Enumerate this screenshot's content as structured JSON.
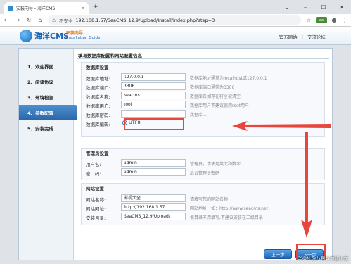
{
  "browser": {
    "tab_title": "安装向导 - 海洋CMS",
    "not_secure": "不安全",
    "url": "192.168.1.57/SeaCMS_12.9/Upload/Install/index.php?step=3",
    "ext_badge": "aa"
  },
  "header": {
    "logo_text": "海洋CMS",
    "guide_cn": "安装向导",
    "guide_en": "Installation Guide",
    "link_official": "官方网站",
    "link_separator": "|",
    "link_forum": "交流论坛"
  },
  "sidebar": {
    "items": [
      {
        "label": "1、欢迎界面"
      },
      {
        "label": "2、阅读协议"
      },
      {
        "label": "3、环境检测"
      },
      {
        "label": "4、参数配置"
      },
      {
        "label": "5、安装完成"
      }
    ]
  },
  "content": {
    "title": "填写数据库配置和网站配置信息",
    "db": {
      "heading": "数据库设置",
      "host": {
        "label": "数据库地址:",
        "value": "127.0.0.1",
        "hint": "数据库地址通常为localhost或127.0.0.1"
      },
      "port": {
        "label": "数据库端口:",
        "value": "3306",
        "hint": "数据库端口通常为3306"
      },
      "name": {
        "label": "数据库名称:",
        "value": "seacms",
        "hint": "数据库名如存在将全被清空"
      },
      "user": {
        "label": "数据库用户:",
        "value": "root",
        "hint": "数据库用户不建议使用root用户"
      },
      "password": {
        "label": "数据库密码:",
        "value": "",
        "hint": "数据库..."
      },
      "charset": {
        "label": "数据库编码:",
        "value": "UTF8"
      }
    },
    "admin": {
      "heading": "管理员设置",
      "username": {
        "label": "用户名:",
        "value": "admin",
        "hint": "管理员，请使用英文和数字"
      },
      "password": {
        "label": "密　码:",
        "value": "admin",
        "hint": "后台管理员密码"
      }
    },
    "site": {
      "heading": "网站设置",
      "sitename": {
        "label": "网站名称:",
        "value": "影视大全",
        "hint": "请填写您的网站名称"
      },
      "siteurl": {
        "label": "网站网址:",
        "value": "http://192.168.1.57",
        "hint": "网站地址，如：http://www.seacms.net"
      },
      "path": {
        "label": "安装目录:",
        "value": "SeaCMS_12.9/Upload/",
        "hint": "根目录不用填写,不建议安装在二级目录"
      }
    },
    "btn_prev": "上一步",
    "btn_next": "下一步"
  },
  "watermark": "CSDN @八月写做蓝小龙",
  "colors": {
    "accent": "#1e64b2",
    "annotation": "#e8453c"
  }
}
